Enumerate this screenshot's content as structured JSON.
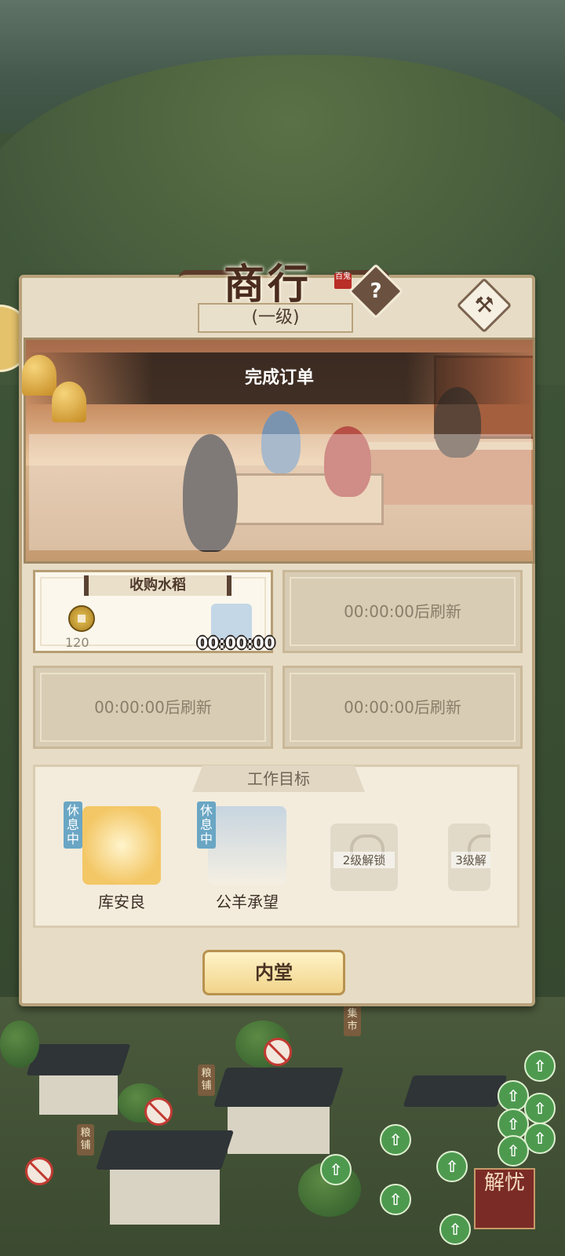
{
  "panel": {
    "title": "商行",
    "title_stamp": "百鬼",
    "level": "(一级)",
    "help_icon": "question-mark-icon",
    "build_icon": "hammer-icon",
    "scene_banner": "完成订单"
  },
  "orders": [
    {
      "tag": "收购水稻",
      "reward": "120",
      "timer": "00:00:00",
      "active": true
    },
    {
      "wait_text": "00:00:00后刷新"
    },
    {
      "wait_text": "00:00:00后刷新"
    },
    {
      "wait_text": "00:00:00后刷新"
    }
  ],
  "goal": {
    "title": "工作目标",
    "workers": [
      {
        "name": "库安良",
        "status": "休息中"
      },
      {
        "name": "公羊承望",
        "status": "休息中"
      }
    ],
    "locked_slots": [
      {
        "label": "2级解锁"
      },
      {
        "label": "3级解"
      }
    ]
  },
  "buttons": {
    "inner_hall": "内堂"
  },
  "map": {
    "shop_signs": [
      "粮铺",
      "粮铺",
      "集市"
    ],
    "jieyou_label": "解忧"
  },
  "colors": {
    "panel_bg": "#e7dcc6",
    "accent_gold": "#f1d48a",
    "rest_tag": "#6aa6c4",
    "map_green": "#3e5237"
  }
}
